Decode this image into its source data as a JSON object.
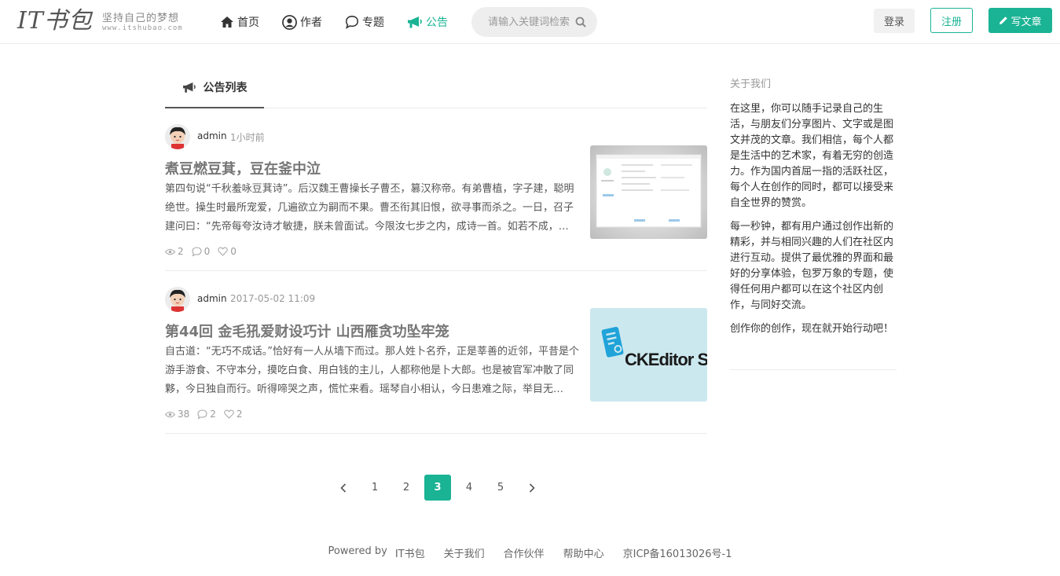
{
  "logo": {
    "main": "IT书包",
    "slogan": "坚持自己的梦想",
    "url": "www.itshubao.com"
  },
  "nav": [
    {
      "label": "首页",
      "icon": "home-icon",
      "active": false
    },
    {
      "label": "作者",
      "icon": "user-circle-icon",
      "active": false
    },
    {
      "label": "专题",
      "icon": "speech-bubble-icon",
      "active": false
    },
    {
      "label": "公告",
      "icon": "megaphone-icon",
      "active": true
    }
  ],
  "search": {
    "placeholder": "请输入关键词检索",
    "icon": "search-icon"
  },
  "auth": {
    "login": "登录",
    "register": "注册",
    "write": "写文章"
  },
  "tab": {
    "label": "公告列表",
    "icon": "megaphone-icon"
  },
  "articles": [
    {
      "author": "admin",
      "time": "1小时前",
      "title": "煮豆燃豆萁，豆在釜中泣",
      "summary": "第四句说“千秋羞咏豆萁诗”。后汉魏王曹操长子曹丕，篡汉称帝。有弟曹植，字子建，聪明绝世。操生时最所宠爱，几遍欲立为嗣而不果。曹丕衔其旧恨，欲寻事而杀之。一日，召子建问曰：“先帝每夸汝诗才敏捷，朕未曾面试。今限汝七步之内，成诗一首。如若不成，…",
      "views": "2",
      "comments": "0",
      "likes": "0",
      "thumb": "screenshot-thumbnail"
    },
    {
      "author": "admin",
      "time": "2017-05-02 11:09",
      "title": "第44回 金毛犼爱财设巧计 山西雁贪功坠牢笼",
      "summary": "自古道：“无巧不成话。”恰好有一人从墙下而过。那人姓卜名乔，正是莘善的近邻，平昔是个游手游食、不守本分，摸吃白食、用白钱的主儿，人都称他是卜大郎。也是被官军冲散了同夥，今日独自而行。听得啼哭之声，慌忙来看。瑶琴自小相认，今日患难之际，举目无…",
      "views": "38",
      "comments": "2",
      "likes": "2",
      "thumb": "ckeditor-logo",
      "thumb_text": "CKEditor SDK"
    }
  ],
  "pagination": {
    "pages": [
      "1",
      "2",
      "3",
      "4",
      "5"
    ],
    "current": "3"
  },
  "sidebar": {
    "title": "关于我们",
    "paragraphs": [
      "在这里，你可以随手记录自己的生活，与朋友们分享图片、文字或是图文并茂的文章。我们相信，每个人都是生活中的艺术家，有着无穷的创造力。作为国内首屈一指的活跃社区，每个人在创作的同时，都可以接受来自全世界的赞赏。",
      "每一秒钟，都有用户通过创作出新的精彩，并与相同兴趣的人们在社区内进行互动。提供了最优雅的界面和最好的分享体验，包罗万象的专题，使得任何用户都可以在这个社区内创作，与同好交流。",
      "创作你的创作，现在就开始行动吧！"
    ]
  },
  "footer": {
    "powered": "Powered by",
    "brand": "IT书包",
    "links": [
      "关于我们",
      "合作伙伴",
      "帮助中心",
      "京ICP备16013026号-1"
    ]
  },
  "colors": {
    "accent": "#1ab394",
    "border": "#ebebeb",
    "muted": "#999999"
  }
}
